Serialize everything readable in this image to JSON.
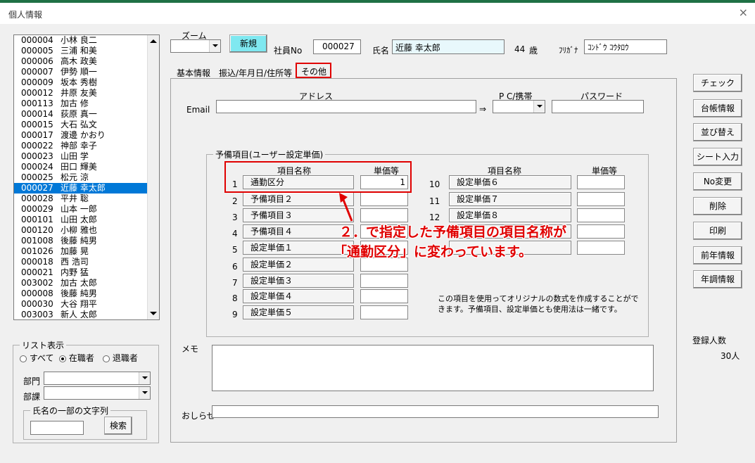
{
  "window": {
    "title": "個人情報",
    "close": "×"
  },
  "employee_list": [
    {
      "no": "000004",
      "name": "小林 良二"
    },
    {
      "no": "000005",
      "name": "三浦 和美"
    },
    {
      "no": "000006",
      "name": "高木 政美"
    },
    {
      "no": "000007",
      "name": "伊勢 順一"
    },
    {
      "no": "000009",
      "name": "坂本 秀樹"
    },
    {
      "no": "000012",
      "name": "井原 友美"
    },
    {
      "no": "000113",
      "name": "加古 修"
    },
    {
      "no": "000014",
      "name": "荻原 真一"
    },
    {
      "no": "000015",
      "name": "大石 弘文"
    },
    {
      "no": "000017",
      "name": "渡邊 かおり"
    },
    {
      "no": "000022",
      "name": "神部 幸子"
    },
    {
      "no": "000023",
      "name": "山田 学"
    },
    {
      "no": "000024",
      "name": "田口 輝美"
    },
    {
      "no": "000025",
      "name": "松元 涼"
    },
    {
      "no": "000027",
      "name": "近藤 幸太郎"
    },
    {
      "no": "000028",
      "name": "平井 聡"
    },
    {
      "no": "000029",
      "name": "山本 一郎"
    },
    {
      "no": "000101",
      "name": "山田 太郎"
    },
    {
      "no": "000120",
      "name": "小柳 雅也"
    },
    {
      "no": "001008",
      "name": "後藤 純男"
    },
    {
      "no": "001026",
      "name": "加藤 晃"
    },
    {
      "no": "000018",
      "name": "西 浩司"
    },
    {
      "no": "000021",
      "name": "内野 猛"
    },
    {
      "no": "003002",
      "name": "加古 太郎"
    },
    {
      "no": "000008",
      "name": "後藤 純男"
    },
    {
      "no": "000030",
      "name": "大谷 翔平"
    },
    {
      "no": "003003",
      "name": "新人 太郎"
    }
  ],
  "selected_employee_no": "000027",
  "list_display": {
    "title": "リスト表示",
    "options": [
      "すべて",
      "在職者",
      "退職者"
    ],
    "selected": "在職者",
    "dept_label": "部門",
    "section_label": "部課",
    "name_search_title": "氏名の一部の文字列",
    "search_button": "検索"
  },
  "header": {
    "zoom_label": "ズーム",
    "new_button": "新規",
    "emp_no_label": "社員No",
    "emp_no": "000027",
    "name_label": "氏名",
    "name": "近藤 幸太郎",
    "age": "44",
    "age_unit": "歳",
    "furigana_label": "ﾌﾘｶﾞﾅ",
    "furigana": "ｺﾝﾄﾞｳ ｺｳﾀﾛｳ"
  },
  "tabs": [
    "基本情報",
    "振込/年月日/住所等",
    "その他"
  ],
  "active_tab": "その他",
  "email": {
    "address_header": "アドレス",
    "pc_header": "P C/携帯",
    "password_header": "パスワード",
    "label": "Email",
    "arrow": "⇒"
  },
  "reserve": {
    "group_title": "予備項目(ユーザー設定単価)",
    "name_header": "項目名称",
    "price_header": "単価等",
    "left_items": [
      {
        "idx": "1",
        "name": "通勤区分",
        "value": "1"
      },
      {
        "idx": "2",
        "name": "予備項目２",
        "value": ""
      },
      {
        "idx": "3",
        "name": "予備項目３",
        "value": ""
      },
      {
        "idx": "4",
        "name": "予備項目４",
        "value": ""
      },
      {
        "idx": "5",
        "name": "設定単価１",
        "value": ""
      },
      {
        "idx": "6",
        "name": "設定単価２",
        "value": ""
      },
      {
        "idx": "7",
        "name": "設定単価３",
        "value": ""
      },
      {
        "idx": "8",
        "name": "設定単価４",
        "value": ""
      },
      {
        "idx": "9",
        "name": "設定単価５",
        "value": ""
      }
    ],
    "right_items": [
      {
        "idx": "10",
        "name": "設定単価６",
        "value": ""
      },
      {
        "idx": "11",
        "name": "設定単価７",
        "value": ""
      },
      {
        "idx": "12",
        "name": "設定単価８",
        "value": ""
      },
      {
        "idx": "",
        "name": "",
        "value": ""
      },
      {
        "idx": "",
        "name": "",
        "value": ""
      }
    ],
    "note_line1": "この項目を使用ってオリジナルの数式を作成することがで",
    "note_line2": "きます。予備項目、設定単価とも使用法は一緒です。"
  },
  "memo_label": "メモ",
  "notice_label": "おしらせ",
  "callout": {
    "line1": "２．で指定した予備項目の項目名称が",
    "line2": "「通勤区分」に変わっています。",
    "color": "#e00000"
  },
  "side_buttons": [
    "チェック",
    "台帳情報",
    "並び替え",
    "シート入力",
    "No変更",
    "削除",
    "印刷",
    "前年情報",
    "年調情報"
  ],
  "registered": {
    "label": "登録人数",
    "count": "30人"
  }
}
